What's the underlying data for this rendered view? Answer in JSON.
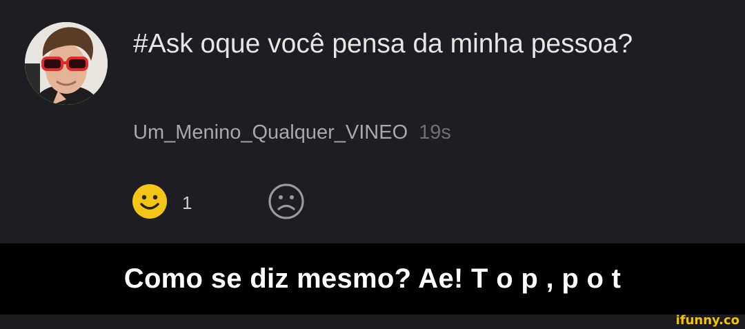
{
  "post": {
    "question": "#Ask oque você pensa da minha pessoa?",
    "username": "Um_Menino_Qualquer_VINEO",
    "time": "19s"
  },
  "reactions": {
    "happy_icon": "smiley-face-icon",
    "happy_count": "1",
    "sad_icon": "sad-face-icon"
  },
  "caption": "Como se diz mesmo? Ae! T o p , p o t",
  "watermark": "ifunny.co",
  "colors": {
    "background": "#1e1e22",
    "caption_bar": "#000000",
    "smiley": "#f2c518",
    "watermark": "#f5c400"
  }
}
